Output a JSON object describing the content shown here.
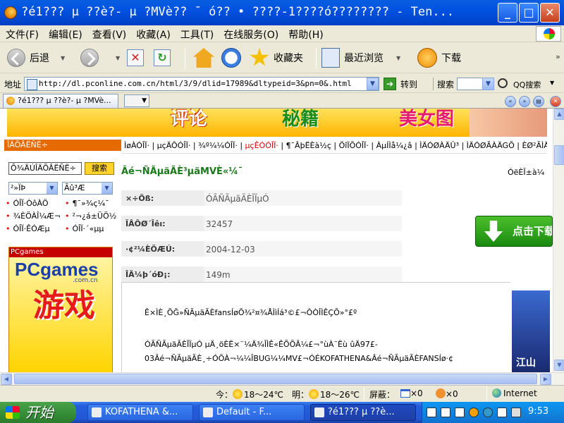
{
  "window": {
    "title": "?é1??? µ ??è?- µ ?MVè?? ¯  ó?? • ????-1????ó????????  -  Ten...",
    "controls": {
      "minimize": "_",
      "maximize": "□",
      "close": "✕"
    }
  },
  "menu": [
    "文件(F)",
    "编辑(E)",
    "查看(V)",
    "收藏(A)",
    "工具(T)",
    "在线服务(O)",
    "帮助(H)"
  ],
  "toolbar": {
    "back": "后退",
    "favorites": "收藏夹",
    "history": "最近浏览",
    "download": "下载"
  },
  "address": {
    "label": "地址",
    "url": "http://dl.pconline.com.cn/html/3/9/dlid=17989&dltypeid=3&pn=0&.html",
    "go": "转到",
    "search_label": "搜索",
    "qq_search": "QQ搜索"
  },
  "tabs": {
    "active": "?é1??? µ ??è?- µ ?MVè..."
  },
  "page": {
    "banner": {
      "b1": "评论",
      "b2": "秘籍",
      "b3": "美女图"
    },
    "sidebar": {
      "header": "ÎÄÕÂËÑË÷",
      "search_value": "Õ¾ÄÚÎÄÕÂËÑË÷",
      "search_button": "搜索",
      "select1": "²»ÏÞ",
      "select2": "Ãû³Æ",
      "links": [
        "ÓÎÏ·ÒôÀÖ",
        "¶¯»­¾ç¼¯",
        "¾­ÈÖÀÎ¼Æ¬",
        "²¬¿á±ÜÖ½",
        "ÓÎÏ·ÊÓÆµ",
        "ÓÎÏ·´«µµ"
      ],
      "ad": {
        "header": "PCgames",
        "logo": "PCgames",
        "sub": ".com.cn",
        "big": "游戏"
      }
    },
    "nav": {
      "before": "ÌøÀ­ÓÎÏ· | µçÄÔÓÎÏ· | ¾º¼¼ÓÎÏ· | ",
      "active": "µçÊÓÓÎÏ·",
      "after": " | ¶¯ÂþËÈà½ç | ÖîÏÕÓÎÏ· | ÀµÍÌå¼¿â | ÌÄÓØÀÄÛ³ | ÌÄÓØÃÀÄGÕ | ÈØ²ÃÌÄÓØ"
    },
    "title": "Âé¬ÑÃµäÃÈ³µäMVÈ«¼¯",
    "title_right": "ÓëÈÎ±à¼­",
    "info": [
      {
        "key": "×÷Õß:",
        "value": "ÓÃÑÃµäÃÈÎÏµÓ"
      },
      {
        "key": "ÏÂÔØ´Îêı:",
        "value": "32457"
      },
      {
        "key": "·¢²¼ÈÕÆÚ:",
        "value": "2004-12-03"
      },
      {
        "key": "ÎÄ¼þ´óÐ¡:",
        "value": "149m"
      }
    ],
    "download_badge": "点击下载",
    "desc1": "Ê×ÌÈ¸ÕĞ»ÑÃµäÃÈfansÍøÕ¾²¤¾ÅÌìÍá³©£¬ÔÒÎÌÊÇÕ»°£º",
    "desc2": [
      "ÓÃÑÃµäÃÈÎÏµÓ µÄ¸öÈË×¨¼­Ä¾ÎÌÊ«ÊÕÕÂ¼£¬°ùÀ¨Ëù ûÄ97£-",
      "03Âé¬ÑÃµäÃÈ¸÷ÓÖÀ¬¼¼ÎBUG¼¼MV£¬ÓÉKOFATHENA&Âé¬ÑÃµäÃÈFANSÍø·¢"
    ],
    "side_img_text": "江山"
  },
  "status": {
    "today_label": "今：",
    "today_temp": "18～24℃",
    "tomorrow_label": "明：",
    "tomorrow_temp": "18～26℃",
    "block_label": "屏蔽：",
    "block1": "×0",
    "block2": "×0",
    "zone": "Internet"
  },
  "taskbar": {
    "start": "开始",
    "tasks": [
      "KOFATHENA &...",
      "Default - F...",
      "?é1??? µ ??è..."
    ],
    "clock": "9:53"
  }
}
